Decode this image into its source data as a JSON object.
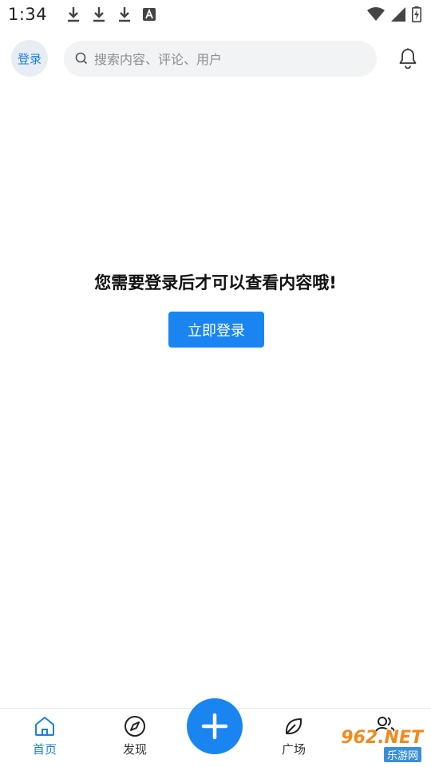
{
  "status_bar": {
    "time": "1:34",
    "left_icons": [
      "download-icon",
      "download-icon",
      "download-icon",
      "app-a-icon"
    ],
    "right_icons": [
      "wifi-icon",
      "signal-icon",
      "battery-icon"
    ]
  },
  "header": {
    "login_label": "登录",
    "search": {
      "placeholder": "搜索内容、评论、用户",
      "icon": "search-icon"
    },
    "notification_icon": "bell-icon"
  },
  "main": {
    "prompt": "您需要登录后才可以查看内容哦!",
    "login_button": "立即登录"
  },
  "bottom_nav": {
    "items": [
      {
        "label": "首页",
        "icon": "home-icon",
        "active": true
      },
      {
        "label": "发现",
        "icon": "compass-icon",
        "active": false
      },
      {
        "label": "广场",
        "icon": "leaf-icon",
        "active": false
      },
      {
        "label": "",
        "icon": "users-icon",
        "active": false
      }
    ],
    "fab_icon": "plus-icon"
  },
  "watermark": {
    "text": "962.NET",
    "sub": "乐游网"
  },
  "colors": {
    "accent": "#1a85f0",
    "active_text": "#1a7ee6",
    "search_bg": "#f2f3f5"
  }
}
